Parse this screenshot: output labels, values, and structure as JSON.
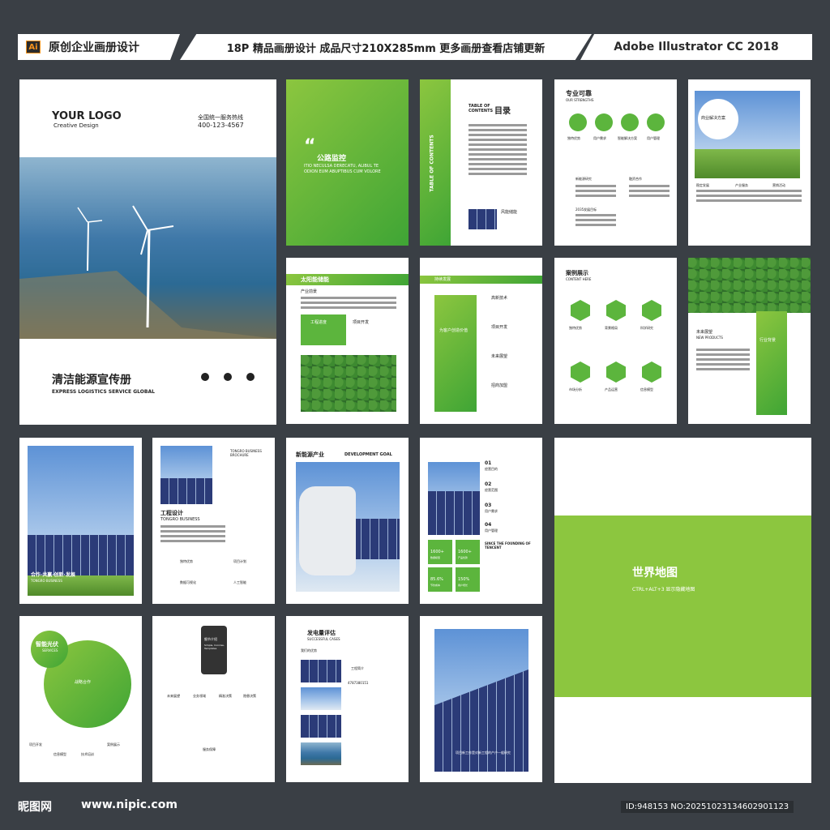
{
  "banner": {
    "left_text": "原创企业画册设计",
    "ai_badge": "Ai",
    "center_text": "18P 精品画册设计 成品尺寸210X285mm 更多画册查看店铺更新",
    "right_text": "Adobe Illustrator CC 2018"
  },
  "cover": {
    "logo": "YOUR LOGO",
    "logo_sub": "Creative Design",
    "hotline": "全国统一服务热线",
    "phone": "400-123-4567",
    "title": "清洁能源宣传册",
    "subtitle": "EXPRESS LOGISTICS SERVICE GLOBAL"
  },
  "p2": {
    "quote": "“",
    "heading": "公路监控",
    "body": "ITIO NECULSA DERECATU, ALIBUL TE ODION EUM ABUPTIBUS CUM VOLORE"
  },
  "p3": {
    "toc_small": "TABLE OF CONTENTS",
    "toc_title": "目录",
    "vertical": "TABLE OF CONTENTS",
    "caption": "风能储能"
  },
  "p4": {
    "title": "专业可靠",
    "sub": "OUR STRENGTHS",
    "icons": [
      "独特优势",
      "用户需求",
      "智能解决方案",
      "用户管理"
    ],
    "items": [
      "新能源研究",
      "融资合作",
      "2035发展目标"
    ]
  },
  "p5": {
    "badge": "商业解决方案",
    "cols": [
      "稳定发展",
      "产业服务",
      "营销活动"
    ]
  },
  "p6": {
    "title": "太阳能储能",
    "sub": "产业前景",
    "box": "工程进度",
    "side": "项目开发"
  },
  "p7": {
    "title": "持续发展",
    "box": "为客户创造价值",
    "items": [
      "高新技术",
      "项目开发",
      "未来展望",
      "招商加盟"
    ]
  },
  "p8": {
    "title": "案例展示",
    "sub": "CONTENT HERE",
    "items": [
      "独特优势",
      "背景格局",
      "科学研究",
      "市场分析",
      "产品运营",
      "信息模型"
    ]
  },
  "p9": {
    "title": "未来展望",
    "sub": "NEW PRODUCTS",
    "box": "行业背景"
  },
  "p10": {
    "caption": "合作·共赢·创新·发展",
    "caption_sub": "TONGRO BUSINESS"
  },
  "p11": {
    "brand": "TONGRO BUSINESS BROCHURE",
    "title": "工程设计",
    "sub": "TONGRO BUSINESS",
    "items": [
      "独特优势",
      "项目计划",
      "数据可视化",
      "人工智能"
    ]
  },
  "p12": {
    "title": "新能源产业",
    "sub": "DEVELOPMENT GOAL"
  },
  "p13": {
    "nums": [
      "01",
      "02",
      "03",
      "04"
    ],
    "labels": [
      "经营目的",
      "经营范围",
      "用户需求",
      "用户管理"
    ],
    "stats": [
      "1600+",
      "1600+",
      "85.6%",
      "150%"
    ],
    "stat_labels": [
      "数据模型",
      "产品优势",
      "节约成本",
      "用户增长"
    ],
    "heading": "SINCE THE FOUNDING OF TENCENT"
  },
  "map": {
    "title": "世界地图",
    "hint": "CTRL+ALT+3 显示隐藏地图"
  },
  "p15": {
    "title": "智能光伏",
    "sub": "SERVICES",
    "center": "战略合作",
    "items": [
      "项目开发",
      "信息模型",
      "技术培训",
      "案例展示"
    ]
  },
  "p16": {
    "phone_title": "细节介绍",
    "phone_sub": "Simple, Concise, Templates",
    "items": [
      "未来展望",
      "业务领域",
      "精准决策",
      "隐患决策"
    ],
    "bottom": "服务保障"
  },
  "p17": {
    "title": "发电量评估",
    "sub": "SUCCESSFUL CASES",
    "label": "我们的优势",
    "intro": "工程简介",
    "phone": "4787380151"
  },
  "p18": {
    "caption": "项目新工作是对新工程的产户一般研究"
  },
  "footer": {
    "logo": "昵图网",
    "url": "www.nipic.com",
    "id": "ID:948153 NO:20251023134602901123"
  }
}
